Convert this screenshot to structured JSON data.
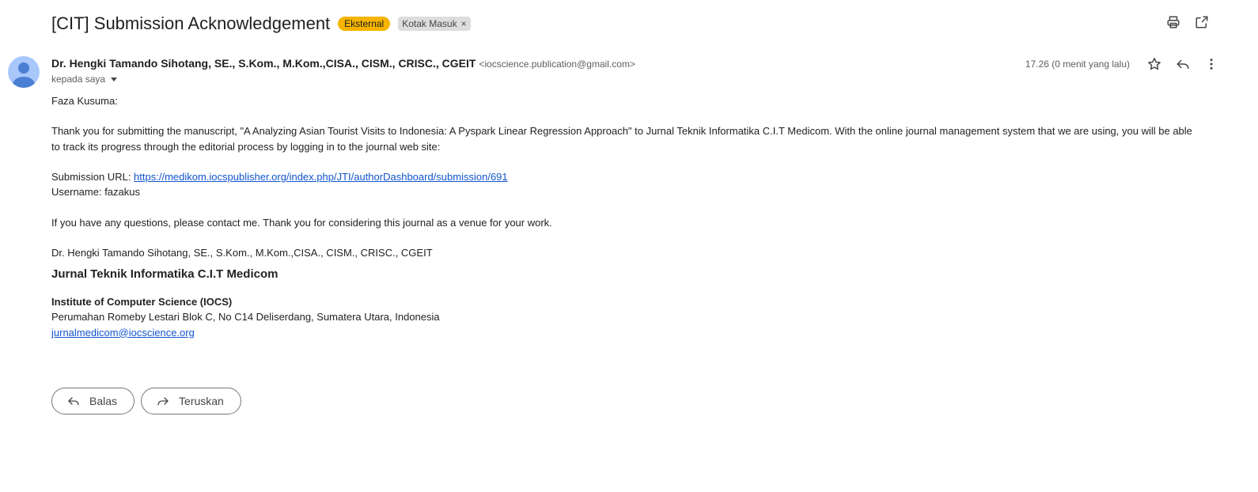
{
  "header": {
    "subject": "[CIT] Submission Acknowledgement",
    "external_label": "Eksternal",
    "inbox_label": "Kotak Masuk",
    "inbox_remove": "×",
    "icons": [
      "print-icon",
      "open-in-new-window-icon"
    ]
  },
  "sender": {
    "name": "Dr. Hengki Tamando Sihotang, SE., S.Kom., M.Kom.,CISA., CISM., CRISC., CGEIT",
    "email": "<iocscience.publication@gmail.com>",
    "to": "kepada saya",
    "time": "17.26 (0 menit yang lalu)",
    "icons": [
      "star-icon",
      "reply-icon",
      "more-vert-icon"
    ]
  },
  "body": {
    "greeting": "Faza Kusuma:",
    "paragraph1": "Thank you for submitting the manuscript, \"A Analyzing Asian Tourist Visits to Indonesia: A Pyspark Linear Regression Approach\" to Jurnal Teknik Informatika C.I.T Medicom. With the online journal management system that we are using, you will be able to track its progress through the editorial process by logging in to the journal web site:",
    "submission_url_label": "Submission URL: ",
    "submission_url": "https://medikom.iocspublisher.org/index.php/JTI/authorDashboard/submission/691",
    "username_line": "Username: fazakus",
    "paragraph2": "If you have any questions, please contact me. Thank you for considering this journal as a venue for your work.",
    "signature": "Dr. Hengki Tamando Sihotang, SE., S.Kom., M.Kom.,CISA., CISM., CRISC., CGEIT",
    "journal_title": "Jurnal Teknik Informatika C.I.T Medicom",
    "institute": "Institute of Computer Science (IOCS)",
    "address": "Perumahan Romeby Lestari Blok C, No C14 Deliserdang, Sumatera Utara, Indonesia",
    "contact_email": "jurnalmedicom@iocscience.org"
  },
  "actions": {
    "reply_label": "Balas",
    "forward_label": "Teruskan"
  },
  "colors": {
    "external_badge": "#f5b400",
    "link": "#1155cc",
    "avatar": "#a8c7fa"
  }
}
